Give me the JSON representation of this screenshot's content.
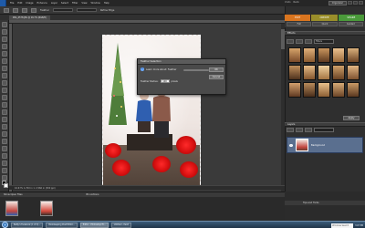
{
  "menubar": {
    "items": [
      "File",
      "Edit",
      "Image",
      "Enhance",
      "Layer",
      "Select",
      "Filter",
      "View",
      "Window",
      "Help"
    ],
    "undo": "Undo",
    "redo": "Redo",
    "organizer": "Organizer"
  },
  "options": {
    "feather_label": "Feather",
    "refine_label": "Refine Edge"
  },
  "document": {
    "tab_title": "IMG_4578.JPG @ 16.7% (RGB/8)",
    "zoom": "16.7%",
    "status_text": "16.67%   1,700 in × 2,566 in (300 ppi)"
  },
  "dialog": {
    "title": "Feather Selection",
    "info_text": "Learn more about: Feather",
    "radius_label": "Feather Radius:",
    "radius_value": "100",
    "unit": "pixels",
    "ok": "OK",
    "cancel": "Cancel"
  },
  "right_panel": {
    "mode_tabs": [
      {
        "label": "EDIT",
        "color": "#d9751f"
      },
      {
        "label": "CREATE",
        "color": "#9a8e2a"
      },
      {
        "label": "SHARE",
        "color": "#4a9a3a"
      }
    ],
    "sub_tabs": [
      "Full",
      "Quick",
      "Guided"
    ],
    "effects_header": "Effects",
    "effects_select": "Filters",
    "apply": "Apply",
    "layers_header": "Layers",
    "layer_name": "Background"
  },
  "bin": {
    "label": "Show Open Files",
    "actions": "Bin Actions",
    "tray": "Tips and Tricks"
  },
  "taskbar": {
    "tasks": [
      "Betty's Facebook (1 of 2)...",
      "Bookkeeping Post Editor...",
      "Editor - Photoshop El...",
      "Untitled - Paint"
    ],
    "search": "Windows Search",
    "clock": "3:07 PM"
  }
}
